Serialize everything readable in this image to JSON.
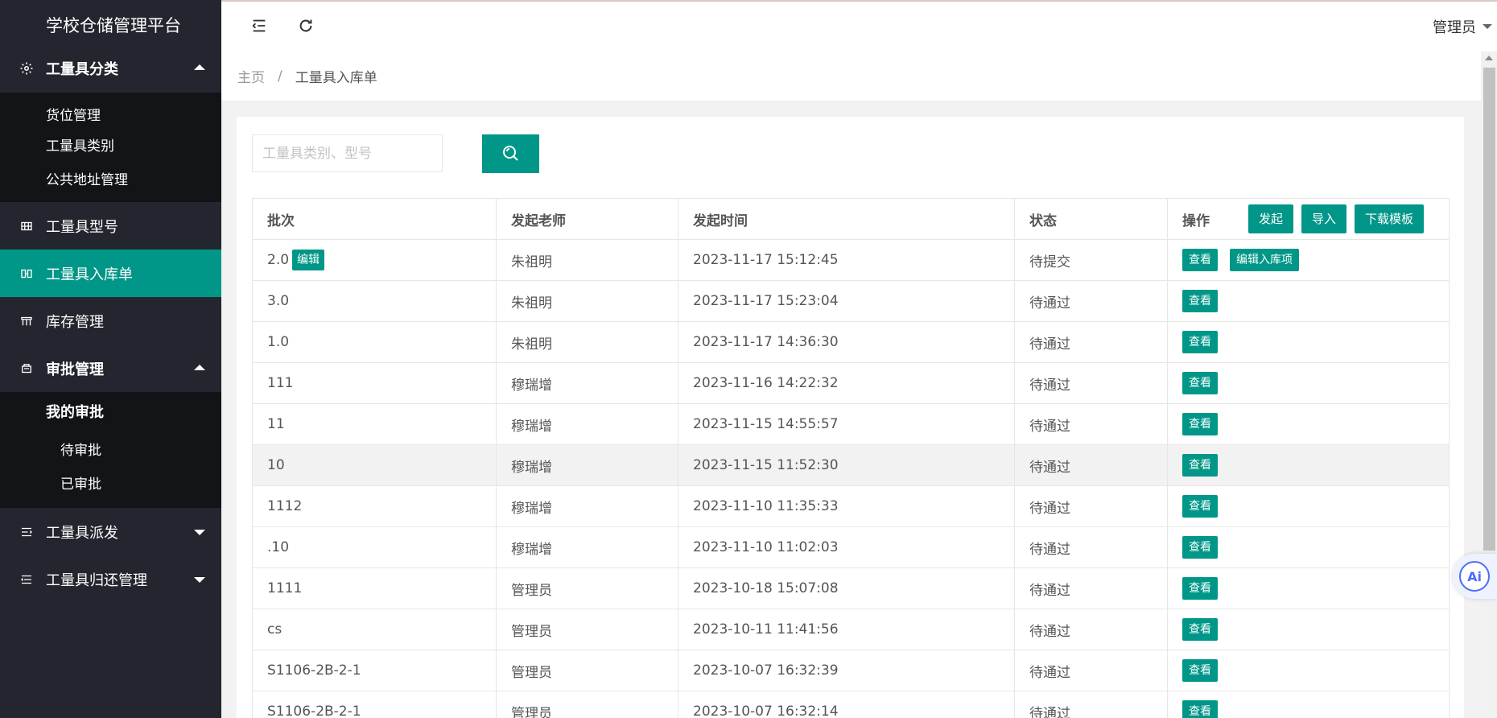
{
  "sidebar": {
    "brand": "学校仓储管理平台",
    "groups": [
      {
        "label": "工量具分类",
        "icon": "gear-icon",
        "expanded": true,
        "children": [
          "货位管理",
          "工量具类别",
          "公共地址管理"
        ]
      },
      {
        "label": "工量具型号",
        "icon": "grid-icon"
      },
      {
        "label": "工量具入库单",
        "icon": "inbound-icon",
        "active": true
      },
      {
        "label": "库存管理",
        "icon": "warehouse-icon"
      },
      {
        "label": "审批管理",
        "icon": "approval-icon",
        "expanded": true,
        "sub_head": "我的审批",
        "children": [
          "待审批",
          "已审批"
        ]
      },
      {
        "label": "工量具派发",
        "icon": "list-icon"
      },
      {
        "label": "工量具归还管理",
        "icon": "list-icon"
      }
    ]
  },
  "header": {
    "user": "管理员"
  },
  "breadcrumb": {
    "home": "主页",
    "separator": "/",
    "current": "工量具入库单"
  },
  "search": {
    "placeholder": "工量具类别、型号"
  },
  "table": {
    "columns": [
      "批次",
      "发起老师",
      "发起时间",
      "状态",
      "操作"
    ],
    "toolbar_buttons": [
      "发起",
      "导入",
      "下载模板"
    ],
    "edit_label": "编辑",
    "view_label": "查看",
    "edit_items_label": "编辑入库项",
    "rows": [
      {
        "batch": "2.0",
        "teacher": "朱祖明",
        "time": "2023-11-17 15:12:45",
        "status": "待提交",
        "editable": true
      },
      {
        "batch": "3.0",
        "teacher": "朱祖明",
        "time": "2023-11-17 15:23:04",
        "status": "待通过"
      },
      {
        "batch": "1.0",
        "teacher": "朱祖明",
        "time": "2023-11-17 14:36:30",
        "status": "待通过"
      },
      {
        "batch": "111",
        "teacher": "穆瑞增",
        "time": "2023-11-16 14:22:32",
        "status": "待通过"
      },
      {
        "batch": "11",
        "teacher": "穆瑞增",
        "time": "2023-11-15 14:55:57",
        "status": "待通过"
      },
      {
        "batch": "10",
        "teacher": "穆瑞增",
        "time": "2023-11-15 11:52:30",
        "status": "待通过",
        "hover": true
      },
      {
        "batch": "1112",
        "teacher": "穆瑞增",
        "time": "2023-11-10 11:35:33",
        "status": "待通过"
      },
      {
        "batch": ".10",
        "teacher": "穆瑞增",
        "time": "2023-11-10 11:02:03",
        "status": "待通过"
      },
      {
        "batch": "1111",
        "teacher": "管理员",
        "time": "2023-10-18 15:07:08",
        "status": "待通过"
      },
      {
        "batch": "cs",
        "teacher": "管理员",
        "time": "2023-10-11 11:41:56",
        "status": "待通过"
      },
      {
        "batch": "S1106-2B-2-1",
        "teacher": "管理员",
        "time": "2023-10-07 16:32:39",
        "status": "待通过"
      },
      {
        "batch": "S1106-2B-2-1",
        "teacher": "管理员",
        "time": "2023-10-07 16:32:14",
        "status": "待通过"
      }
    ]
  },
  "ai_button": "Ai",
  "colors": {
    "accent": "#009688",
    "sidebar": "#23262e",
    "submenu": "#121418"
  }
}
